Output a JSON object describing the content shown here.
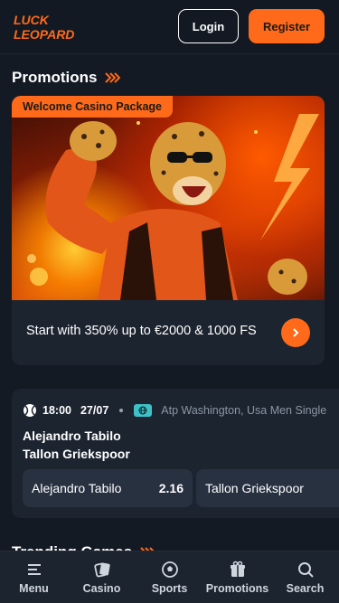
{
  "header": {
    "logo_line1": "LUCK",
    "logo_line2": "LEOPARD",
    "login_label": "Login",
    "register_label": "Register"
  },
  "promotions": {
    "title": "Promotions",
    "card": {
      "tag": "Welcome Casino Package",
      "text": "Start with 350% up to €2000 & 1000 FS"
    }
  },
  "match": {
    "time": "18:00",
    "date": "27/07",
    "league": "Atp Washington, Usa Men Single",
    "team1": "Alejandro Tabilo",
    "team2": "Tallon Griekspoor",
    "odds": [
      {
        "label": "Alejandro Tabilo",
        "value": "2.16"
      },
      {
        "label": "Tallon Griekspoor",
        "value": ""
      }
    ]
  },
  "trending": {
    "title": "Trending Games"
  },
  "bottom_nav": [
    {
      "label": "Menu",
      "icon": "menu-icon"
    },
    {
      "label": "Casino",
      "icon": "casino-icon"
    },
    {
      "label": "Sports",
      "icon": "soccer-ball-icon"
    },
    {
      "label": "Promotions",
      "icon": "gift-icon"
    },
    {
      "label": "Search",
      "icon": "search-icon"
    }
  ],
  "colors": {
    "accent": "#ff6a1a",
    "background": "#141a24",
    "card": "#1c2430"
  }
}
